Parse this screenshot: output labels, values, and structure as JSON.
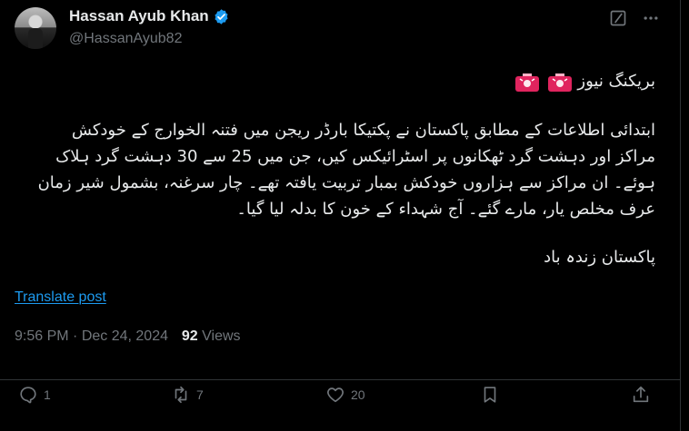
{
  "user": {
    "name": "Hassan Ayub Khan",
    "handle": "@HassanAyub82"
  },
  "tweet": {
    "headline": "بریکنگ نیوز",
    "lines": [
      "ابتدائی اطلاعات کے مطابق پاکستان نے پکتیکا بارڈر ریجن میں فتنہ الخوارج کے خودکش",
      "مراکز اور دہشت گرد ٹھکانوں پر اسٹرائیکس کیں، جن میں 25 سے 30 دہشت گرد ہلاک",
      "ہوئے۔ ان مراکز سے ہزاروں خودکش بمبار تربیت یافتہ تھے۔ چار سرغنہ، بشمول شیر زمان",
      "عرف مخلص یار، مارے گئے۔ آج شہداء کے خون کا بدلہ لیا گیا۔"
    ],
    "closing": "پاکستان زندہ باد"
  },
  "translate_label": "Translate post",
  "meta": {
    "time": "9:56 PM",
    "sep": " · ",
    "date": "Dec 24, 2024",
    "views_count": "92",
    "views_label": " Views"
  },
  "actions": {
    "reply_count": "1",
    "retweet_count": "7",
    "like_count": "20"
  },
  "colors": {
    "background": "#000000",
    "text": "#e7e9ea",
    "muted": "#71767b",
    "link": "#1d9bf0",
    "verified": "#1d9bf0",
    "siren": "#e0245e"
  },
  "icons": [
    "verified-badge-icon",
    "grok-icon",
    "more-icon",
    "siren-icon",
    "reply-icon",
    "retweet-icon",
    "like-icon",
    "bookmark-icon",
    "share-icon"
  ]
}
